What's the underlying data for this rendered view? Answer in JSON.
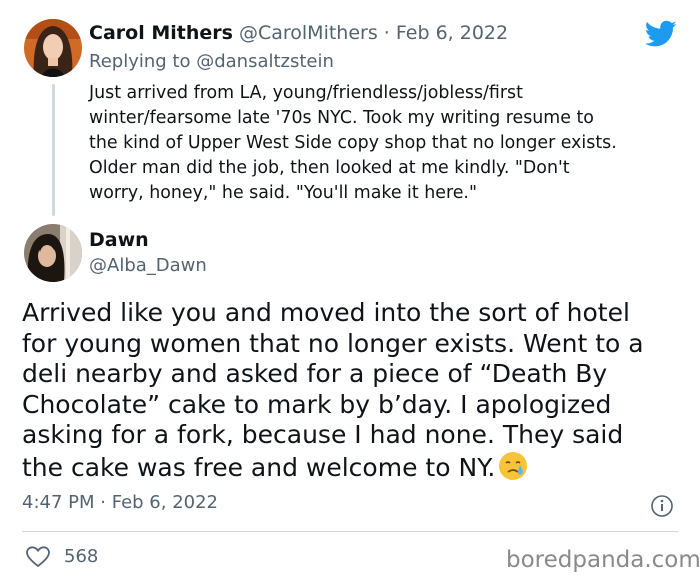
{
  "tweet1": {
    "author_name": "Carol Mithers",
    "author_handle": "@CarolMithers",
    "date": "Feb 6, 2022",
    "replying_to": "Replying to @dansaltzstein",
    "lines": [
      "Just arrived from LA, young/friendless/jobless/first",
      "winter/fearsome late '70s NYC. Took my writing resume to",
      "the kind of Upper West Side copy shop that no longer exists.",
      "Older man did the job, then looked at me kindly. \"Don't",
      "worry, honey,\" he said. \"You'll make it here.\""
    ]
  },
  "tweet2": {
    "author_name": "Dawn",
    "author_handle": "@Alba_Dawn",
    "lines": [
      "Arrived like you and moved into the sort of hotel",
      "for young women that no longer exists. Went to a",
      "deli nearby and asked for a piece of “Death By",
      "Chocolate” cake to mark by b’day. I apologized",
      "asking for a fork, because I had none. They said",
      "the cake was free and welcome to NY."
    ],
    "time": "4:47 PM",
    "date": "Feb 6, 2022",
    "like_count": "568"
  },
  "icons": {
    "brand": "twitter-bird-icon",
    "info": "info-icon",
    "like": "heart-icon",
    "emoji": "face-holding-back-tears"
  },
  "colors": {
    "twitter_blue": "#1d9bf0",
    "secondary_text": "#536471",
    "divider": "#cfd9de"
  },
  "watermark": "boredpanda.com"
}
